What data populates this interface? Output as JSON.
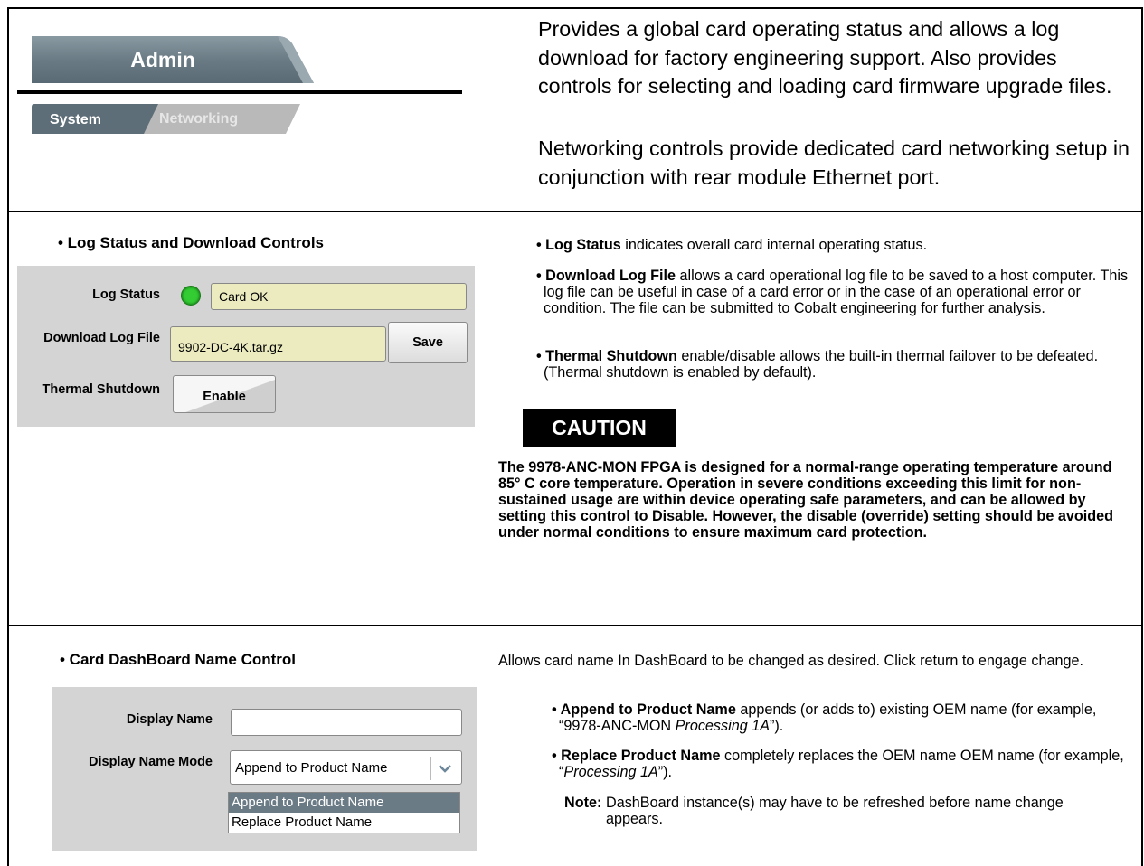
{
  "header": {
    "tab_title": "Admin",
    "subtabs": [
      {
        "label": "System",
        "active": true
      },
      {
        "label": "Networking",
        "active": false
      }
    ],
    "desc_para1": "Provides a global card operating status and allows a log download for factory engineering support. Also provides controls for selecting and loading card firmware upgrade files.",
    "desc_para2": "Networking controls provide dedicated card networking setup in conjunction with rear module Ethernet port."
  },
  "log_section": {
    "heading": "• Log Status and Download Controls",
    "log_status_label": "Log Status",
    "log_status_value": "Card OK",
    "download_label": "Download Log File",
    "download_value": "9902-DC-4K.tar.gz",
    "save_label": "Save",
    "thermal_label": "Thermal Shutdown",
    "thermal_button": "Enable",
    "bullets": [
      {
        "bold": "• Log Status",
        "text": " indicates overall card internal operating status."
      },
      {
        "bold": "• Download Log File",
        "text": " allows a card operational log file to be saved to a host computer. This log file can be useful in case of a card error or in the case of an operational error or condition. The file can be submitted to Cobalt engineering for further analysis."
      },
      {
        "bold": "• Thermal Shutdown",
        "text": " enable/disable allows the built-in thermal failover to be defeated. (Thermal shutdown is enabled by default)."
      }
    ],
    "caution_title": "CAUTION",
    "caution_text": "The 9978-ANC-MON FPGA is designed for a normal-range operating temperature around 85° C core temperature. Operation in severe conditions exceeding this limit for non-sustained usage are within device operating safe parameters, and can be allowed by setting this control to Disable. However, the disable (override) setting should be avoided under normal conditions to ensure maximum card protection."
  },
  "name_section": {
    "heading": "• Card DashBoard Name Control",
    "display_name_label": "Display Name",
    "display_name_value": "",
    "mode_label": "Display Name Mode",
    "mode_selected": "Append to Product Name",
    "mode_options": [
      "Append to Product Name",
      "Replace Product Name"
    ],
    "intro": "Allows card name In DashBoard to be changed as desired. Click return to engage change.",
    "bullet1_bold": "• Append to Product Name",
    "bullet1_pre": " appends (or adds to) existing OEM name (for example, “9978-ANC-MON ",
    "bullet1_ital": "Processing 1A",
    "bullet1_post": "”).",
    "bullet2_bold": "• Replace Product Name",
    "bullet2_pre": " completely replaces the OEM name OEM name (for example, “",
    "bullet2_ital": "Processing 1A",
    "bullet2_post": "”).",
    "note_label": "Note:",
    "note_text": "DashBoard instance(s) may have to be refreshed before name change appears."
  }
}
